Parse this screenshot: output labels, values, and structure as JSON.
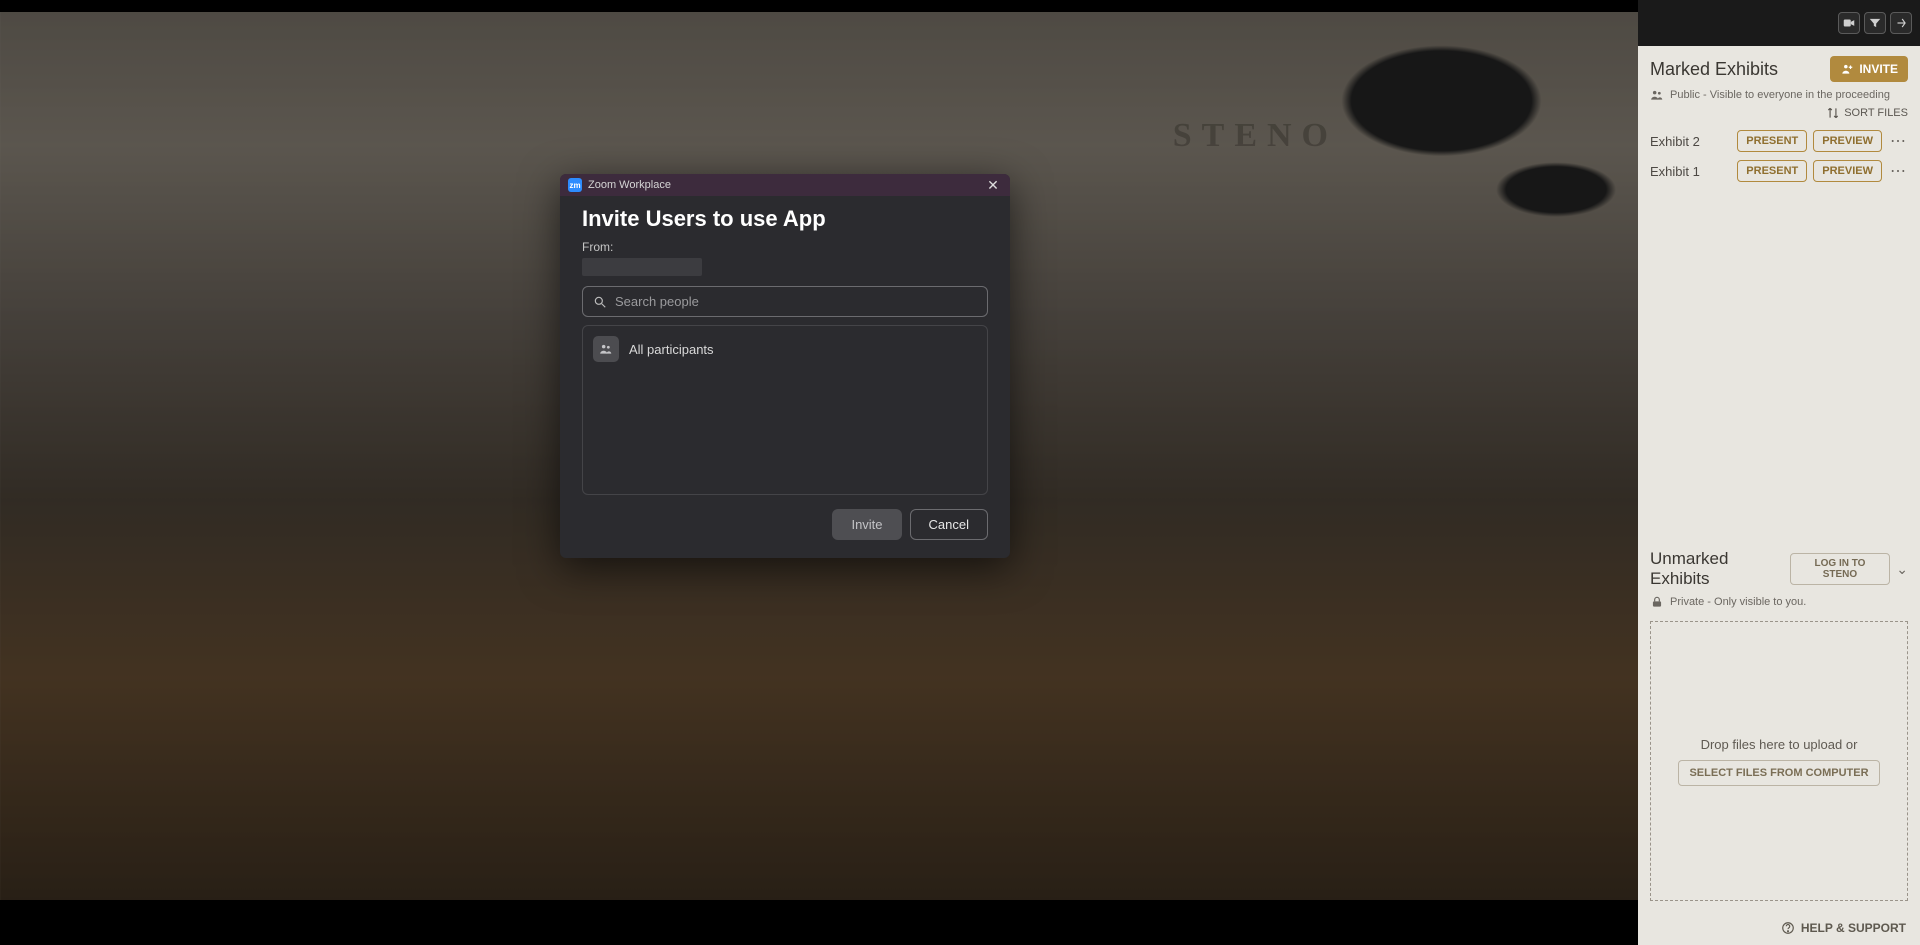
{
  "dialog": {
    "app_name": "Zoom Workplace",
    "heading": "Invite Users to use App",
    "from_label": "From:",
    "search_placeholder": "Search people",
    "all_participants_label": "All participants",
    "invite_label": "Invite",
    "cancel_label": "Cancel"
  },
  "sidebar": {
    "marked": {
      "title": "Marked Exhibits",
      "invite_label": "INVITE",
      "visibility_text": "Public - Visible to everyone in the proceeding",
      "sort_label": "SORT FILES",
      "exhibits": [
        {
          "name": "Exhibit 2",
          "present": "PRESENT",
          "preview": "PREVIEW"
        },
        {
          "name": "Exhibit 1",
          "present": "PRESENT",
          "preview": "PREVIEW"
        }
      ]
    },
    "unmarked": {
      "title": "Unmarked Exhibits",
      "login_label": "LOG IN TO STENO",
      "visibility_text": "Private - Only visible to you.",
      "drop_text": "Drop files here to upload or",
      "select_label": "SELECT FILES FROM COMPUTER"
    },
    "help_label": "HELP & SUPPORT"
  },
  "background_brand": "STENO"
}
